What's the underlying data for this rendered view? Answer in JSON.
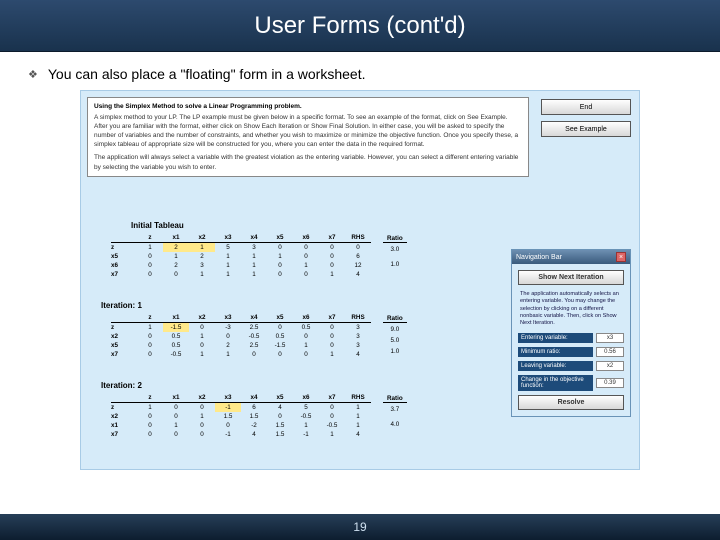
{
  "slide": {
    "title": "User Forms (cont'd)",
    "bullet": "You can also place a \"floating\" form in a worksheet.",
    "page_number": "19"
  },
  "instructions": {
    "heading": "Using the Simplex Method to solve a Linear Programming problem.",
    "p1": "A simplex method to your LP. The LP example must be given below in a specific format. To see an example of the format, click on See Example. After you are familiar with the format, either click on Show Each Iteration or Show Final Solution. In either case, you will be asked to specify the number of variables and the number of constraints, and whether you wish to maximize or minimize the objective function. Once you specify these, a simplex tableau of appropriate size will be constructed for you, where you can enter the data in the required format.",
    "p2": "The application will always select a variable with the greatest violation as the entering variable. However, you can select a different entering variable by selecting the variable you wish to enter."
  },
  "buttons": {
    "end": "End",
    "see_example": "See Example"
  },
  "tableaux": {
    "initial_title": "Initial Tableau",
    "iter1_title": "Iteration: 1",
    "iter2_title": "Iteration: 2",
    "headers": [
      "",
      "z",
      "x1",
      "x2",
      "x3",
      "x4",
      "x5",
      "x6",
      "x7",
      "RHS"
    ],
    "initial": [
      [
        "z",
        "1",
        "2",
        "1",
        "5",
        "3",
        "0",
        "0",
        "0",
        "0"
      ],
      [
        "x5",
        "0",
        "1",
        "2",
        "1",
        "1",
        "1",
        "0",
        "0",
        "6"
      ],
      [
        "x6",
        "0",
        "2",
        "3",
        "1",
        "1",
        "0",
        "1",
        "0",
        "12"
      ],
      [
        "x7",
        "0",
        "0",
        "1",
        "1",
        "1",
        "0",
        "0",
        "1",
        "4"
      ]
    ],
    "ratio_initial": [
      "3.0",
      "",
      "1.0"
    ],
    "iter1": [
      [
        "z",
        "1",
        "-1.5",
        "0",
        "-3",
        "2.5",
        "0",
        "0.5",
        "0",
        "3"
      ],
      [
        "x2",
        "0",
        "0.5",
        "1",
        "0",
        "-0.5",
        "0.5",
        "0",
        "0",
        "3"
      ],
      [
        "x5",
        "0",
        "0.5",
        "0",
        "2",
        "2.5",
        "-1.5",
        "1",
        "0",
        "3"
      ],
      [
        "x7",
        "0",
        "-0.5",
        "1",
        "1",
        "0",
        "0",
        "0",
        "1",
        "4"
      ]
    ],
    "ratio_iter1": [
      "9.0",
      "5.0",
      "1.0"
    ],
    "iter2": [
      [
        "z",
        "1",
        "0",
        "0",
        "-1",
        "6",
        "4",
        "5",
        "0",
        "1"
      ],
      [
        "x2",
        "0",
        "0",
        "1",
        "1.5",
        "1.5",
        "0",
        "-0.5",
        "0",
        "1"
      ],
      [
        "x1",
        "0",
        "1",
        "0",
        "0",
        "-2",
        "1.5",
        "1",
        "-0.5",
        "1"
      ],
      [
        "x7",
        "0",
        "0",
        "0",
        "-1",
        "4",
        "1.5",
        "-1",
        "1",
        "4"
      ]
    ],
    "ratio_iter2": [
      "3.7",
      "",
      "4.0"
    ],
    "ratio_header": "Ratio"
  },
  "navbar": {
    "title": "Navigation Bar",
    "show_next": "Show Next Iteration",
    "note": "The application automatically selects an entering variable. You may change the selection by clicking on a different nonbasic variable. Then, click on Show Next Iteration.",
    "rows": {
      "entering": {
        "label": "Entering variable:",
        "value": "x3"
      },
      "minratio": {
        "label": "Minimum ratio:",
        "value": "0.56"
      },
      "leaving": {
        "label": "Leaving variable:",
        "value": "x2"
      },
      "change": {
        "label": "Change in the objective function:",
        "value": "0.39"
      }
    },
    "resolve": "Resolve"
  }
}
